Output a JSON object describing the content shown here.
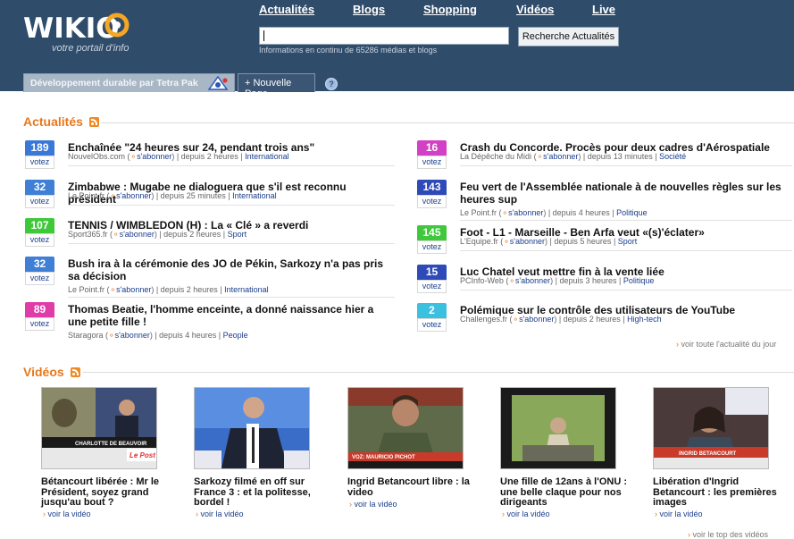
{
  "header": {
    "logo_text": "WIKIO",
    "tagline": "votre portail d'info",
    "nav": [
      "Actualités",
      "Blogs",
      "Shopping",
      "Vidéos",
      "Live"
    ],
    "search_placeholder": "",
    "search_button": "Recherche Actualités",
    "info": "Informations en continu de 65286 médias et blogs",
    "tabs": [
      {
        "label": "Développement durable par Tetra Pak"
      },
      {
        "label": "+ Nouvelle Page"
      }
    ],
    "help": "?"
  },
  "actualites": {
    "title": "Actualités",
    "vote_label": "votez",
    "subscribe": "s'abonner",
    "left": [
      {
        "count": "189",
        "color": "#3a78d8",
        "title": "Enchaînée \"24 heures sur 24, pendant trois ans\"",
        "source": "NouvelObs.com",
        "time": "depuis 2 heures",
        "category": "International"
      },
      {
        "count": "32",
        "color": "#3f7fd6",
        "title": "Zimbabwe : Mugabe ne dialoguera que s'il est reconnu président",
        "source": "Le Point.fr",
        "time": "depuis 25 minutes",
        "category": "International"
      },
      {
        "count": "107",
        "color": "#3ec83a",
        "title": "TENNIS / WIMBLEDON (H) : La « Clé » a reverdi",
        "source": "Sport365.fr",
        "time": "depuis 2 heures",
        "category": "Sport"
      },
      {
        "count": "32",
        "color": "#3f7fd6",
        "title": "Bush ira à la cérémonie des JO de Pékin, Sarkozy n'a pas pris sa décision",
        "source": "Le Point.fr",
        "time": "depuis 2 heures",
        "category": "International"
      },
      {
        "count": "89",
        "color": "#e03ca8",
        "title": "Thomas Beatie, l'homme enceinte, a donné naissance hier a une petite fille !",
        "source": "Staragora",
        "time": "depuis 4 heures",
        "category": "People"
      }
    ],
    "right": [
      {
        "count": "16",
        "color": "#d240c6",
        "title": "Crash du Concorde. Procès pour deux cadres d'Aérospatiale",
        "source": "La Dépêche du Midi",
        "time": "depuis 13 minutes",
        "category": "Société"
      },
      {
        "count": "143",
        "color": "#2e4ab8",
        "title": "Feu vert de l'Assemblée nationale à de nouvelles règles sur les heures sup",
        "source": "Le Point.fr",
        "time": "depuis 4 heures",
        "category": "Politique"
      },
      {
        "count": "145",
        "color": "#3ec83a",
        "title": "Foot - L1 - Marseille - Ben Arfa veut «(s)'éclater»",
        "source": "L'Equipe.fr",
        "time": "depuis 5 heures",
        "category": "Sport"
      },
      {
        "count": "15",
        "color": "#2e4ab8",
        "title": "Luc Chatel veut mettre fin à la vente liée",
        "source": "PCInfo-Web",
        "time": "depuis 3 heures",
        "category": "Politique"
      },
      {
        "count": "2",
        "color": "#3cc0e0",
        "title": "Polémique sur le contrôle des utilisateurs de YouTube",
        "source": "Challenges.fr",
        "time": "depuis 2 heures",
        "category": "High-tech"
      }
    ],
    "more": "voir toute l'actualité du jour"
  },
  "videos": {
    "title": "Vidéos",
    "link_label": "voir la vidéo",
    "items": [
      {
        "title": "Bétancourt libérée : Mr le Président, soyez grand jusqu'au bout ?",
        "caption": "CHARLOTTE DE BEAUVOIR",
        "logo": "Le Post"
      },
      {
        "title": "Sarkozy filmé en off sur France 3 : et la politesse, bordel !",
        "caption": "",
        "logo": ""
      },
      {
        "title": "Ingrid Betancourt libre : la video",
        "caption": "VOZ: MAURICIO PICHOT",
        "logo": ""
      },
      {
        "title": "Une fille de 12ans à l'ONU : une belle claque pour nos dirigeants",
        "caption": "",
        "logo": ""
      },
      {
        "title": "Libération d'Ingrid Betancourt : les premières images",
        "caption": "INGRID BETANCOURT",
        "logo": ""
      }
    ],
    "more": "voir le top des vidéos"
  }
}
